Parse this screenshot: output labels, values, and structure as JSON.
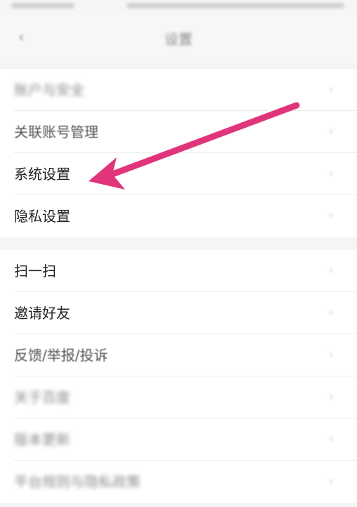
{
  "status_bar": {
    "text": ""
  },
  "header": {
    "title": "设置",
    "back_icon": "chevron-left-icon"
  },
  "section1": {
    "items": [
      {
        "label": "账户与安全"
      },
      {
        "label": "关联账号管理"
      },
      {
        "label": "系统设置"
      },
      {
        "label": "隐私设置"
      }
    ]
  },
  "section2": {
    "items": [
      {
        "label": "扫一扫"
      },
      {
        "label": "邀请好友"
      },
      {
        "label": "反馈/举报/投诉"
      },
      {
        "label": "关于百度"
      },
      {
        "label": "版本更新"
      },
      {
        "label": "平台规则与隐私政策"
      }
    ]
  },
  "annotation": {
    "arrow_color": "#e0357a"
  },
  "colors": {
    "page_bg": "#f5f5f5",
    "row_bg": "#ffffff",
    "divider": "#ececec"
  }
}
